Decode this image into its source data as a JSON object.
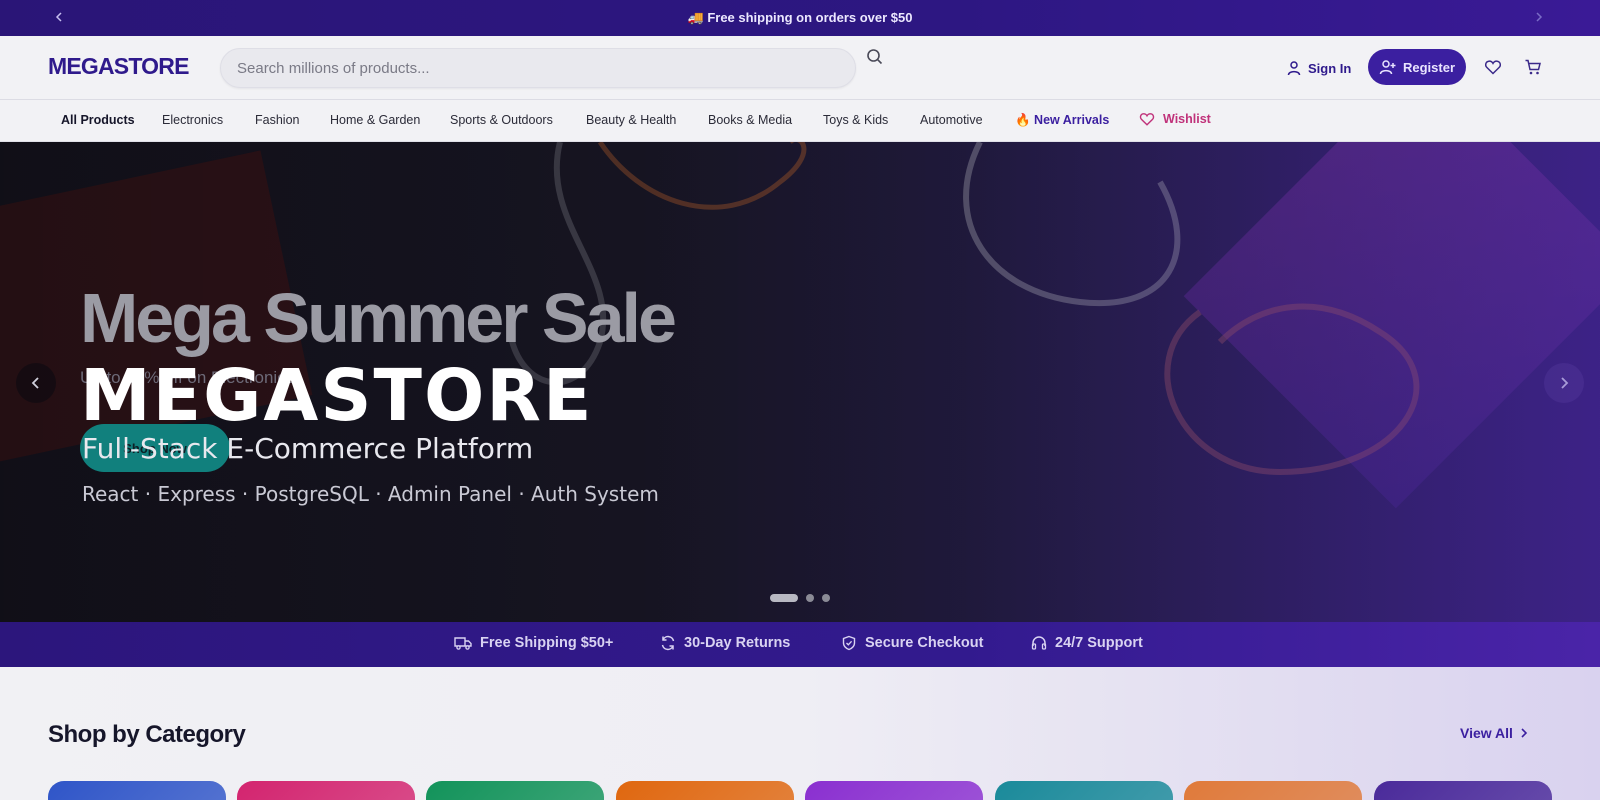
{
  "announcement": {
    "text": "🚚 Free shipping on orders over $50"
  },
  "header": {
    "logo": "MEGASTORE",
    "search_placeholder": "Search millions of products...",
    "sign_in": "Sign In",
    "register": "Register"
  },
  "category_nav": {
    "items": [
      "All Products",
      "Electronics",
      "Fashion",
      "Home & Garden",
      "Sports & Outdoors",
      "Beauty & Health",
      "Books & Media",
      "Toys & Kids",
      "Automotive"
    ],
    "new_arrivals": "🔥 New Arrivals",
    "wishlist": "Wishlist"
  },
  "hero": {
    "slide_title": "Mega Summer Sale",
    "slide_subtitle": "Up to 50% off on Electronics",
    "cta": "Shop Now",
    "brand": "MEGASTORE",
    "tagline": "Full-Stack E-Commerce Platform",
    "stack": "React · Express · PostgreSQL · Admin Panel · Auth System",
    "active_slide": 1,
    "slide_count": 3
  },
  "features": [
    "Free Shipping $50+",
    "30-Day Returns",
    "Secure Checkout",
    "24/7 Support"
  ],
  "categories_section": {
    "title": "Shop by Category",
    "view_all": "View All",
    "card_colors": [
      "#2f55c8",
      "#d3246f",
      "#12935a",
      "#e0670f",
      "#8a2fd0",
      "#1a8a9a",
      "#e07a3a",
      "#4a2a9a"
    ]
  },
  "colors": {
    "brand": "#3b1fa0",
    "accent_teal": "#11807d",
    "wishlist": "#c0327a"
  }
}
